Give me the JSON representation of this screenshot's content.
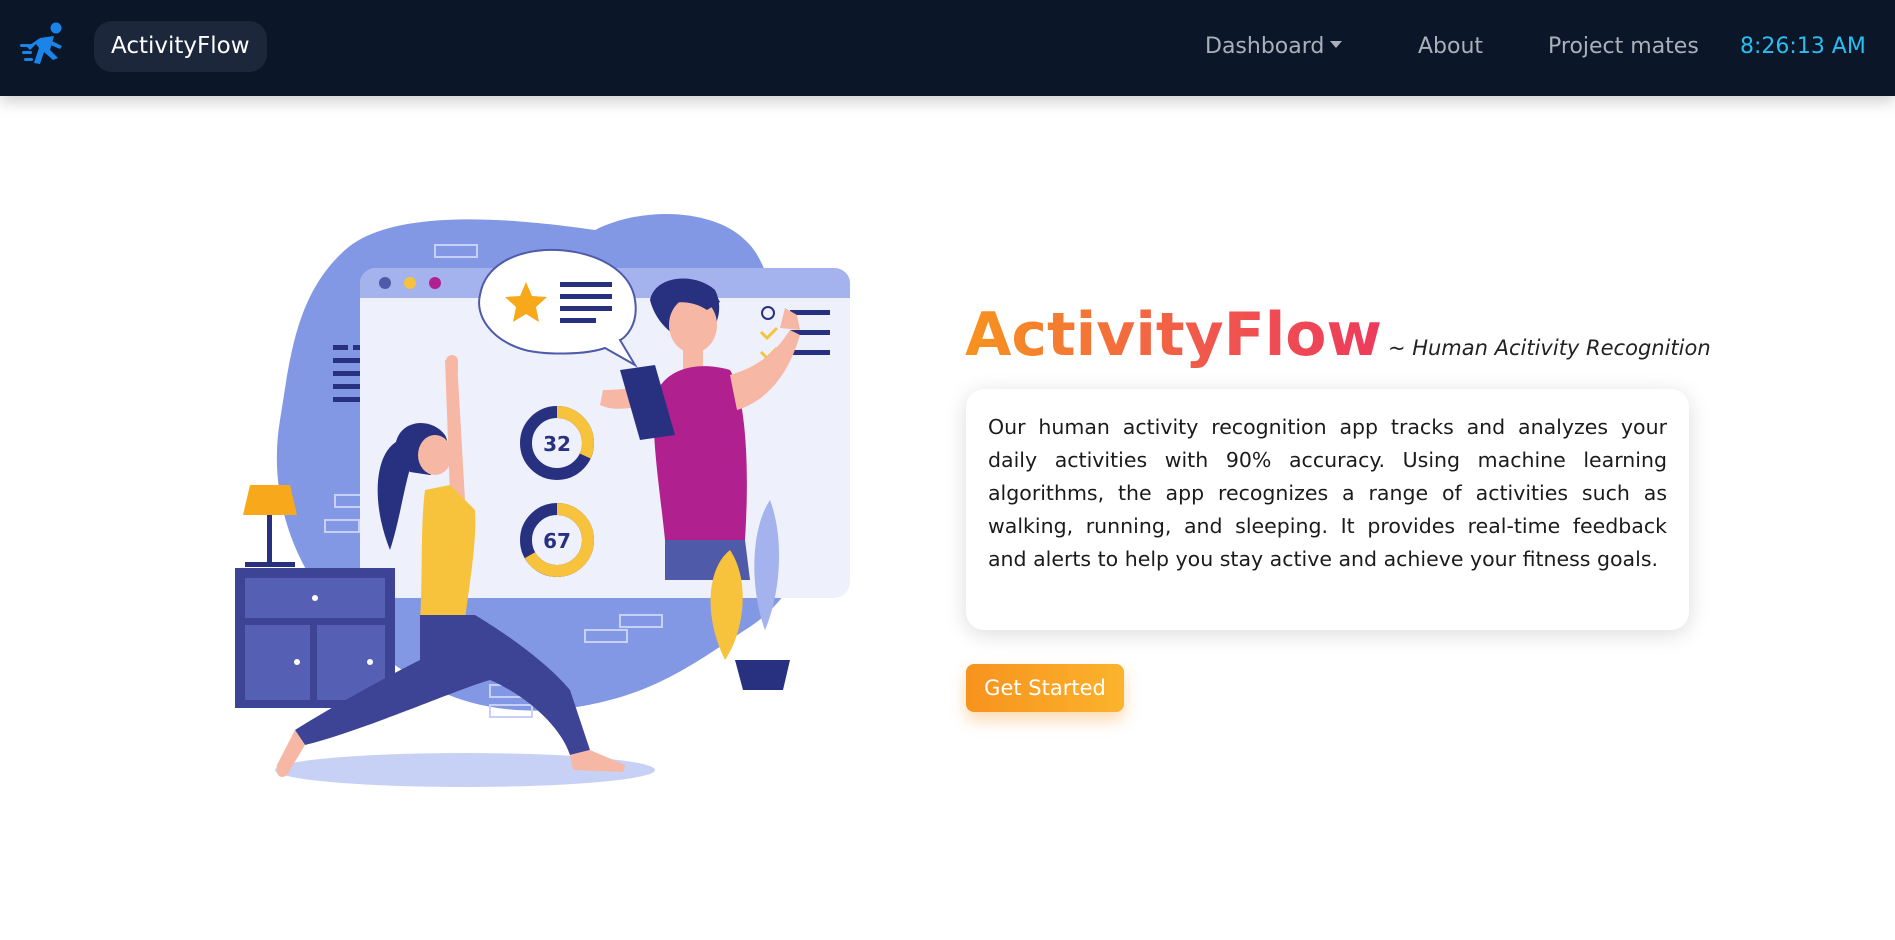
{
  "navbar": {
    "logo_icon": "running-man-icon",
    "brand": "ActivityFlow",
    "items": [
      {
        "label": "Dashboard",
        "has_dropdown": true
      },
      {
        "label": "About",
        "has_dropdown": false
      },
      {
        "label": "Project mates",
        "has_dropdown": false
      }
    ],
    "clock": "8:26:13 AM"
  },
  "hero": {
    "title": "ActivityFlow",
    "subtitle": "~ Human Acitivity Recognition",
    "description": "Our human activity recognition app tracks and analyzes your daily activities with 90% accuracy. Using machine learning algorithms, the app recognizes a range of activities such as walking, running, and sleeping. It provides real-time feedback and alerts to help you stay active and achieve your fitness goals.",
    "cta_label": "Get Started",
    "illustration": {
      "stat_top": "32",
      "stat_bottom": "67"
    }
  },
  "colors": {
    "navbar_bg": "#0c1629",
    "brand_pill_bg": "#1c273c",
    "clock": "#27bff2",
    "title_gradient_start": "#f7931e",
    "title_gradient_end": "#ee3a5c",
    "cta_bg": "#f7931e",
    "illustration_blob": "#8398e4"
  }
}
